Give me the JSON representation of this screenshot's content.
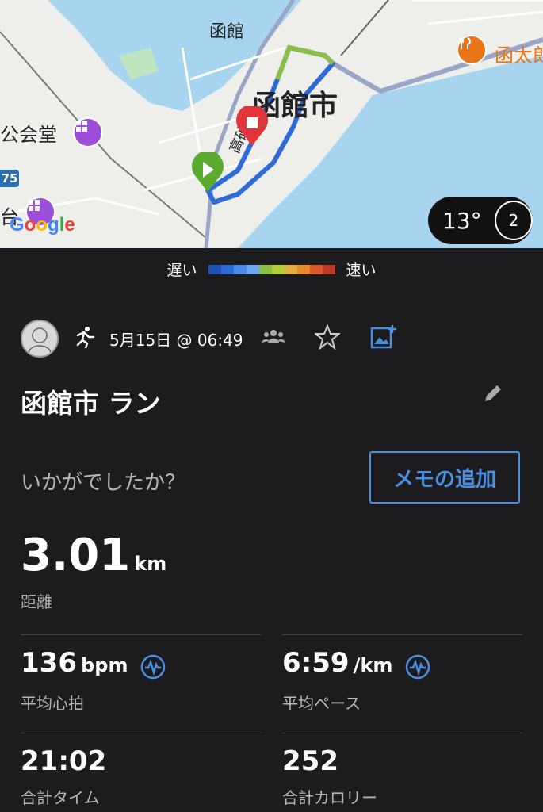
{
  "map": {
    "city_label": "函館市",
    "station_label": "函館",
    "hall_label": "公会堂",
    "dai_label": "台",
    "taka_label": "高砂",
    "restaurant_label": "函太郎",
    "road_number": "75",
    "google_label": "Google"
  },
  "weather": {
    "temperature": "13°",
    "moon_phase": "2"
  },
  "pace_legend": {
    "slow": "遅い",
    "fast": "速い",
    "colors": [
      "#1f4fb0",
      "#2e6bd8",
      "#4a8de8",
      "#6aa7ee",
      "#8ac04a",
      "#b4cd3a",
      "#e0b040",
      "#e88a30",
      "#d85a2a",
      "#c03a2a"
    ]
  },
  "activity": {
    "date": "5月15日 @ 06:49",
    "title": "函館市 ラン",
    "question": "いかがでしたか？",
    "memo_button": "メモの追加"
  },
  "stats": {
    "distance": {
      "value": "3.01",
      "unit": "km",
      "label": "距離"
    },
    "heart_rate": {
      "value": "136",
      "unit": "bpm",
      "label": "平均心拍"
    },
    "pace": {
      "value": "6:59",
      "unit": "/km",
      "label": "平均ペース"
    },
    "time": {
      "value": "21:02",
      "label": "合計タイム"
    },
    "calories": {
      "value": "252",
      "label": "合計カロリー"
    }
  },
  "icons": {
    "accent": "#4a90e2",
    "route_start": "#5aab2e",
    "route_end": "#e0353b"
  }
}
